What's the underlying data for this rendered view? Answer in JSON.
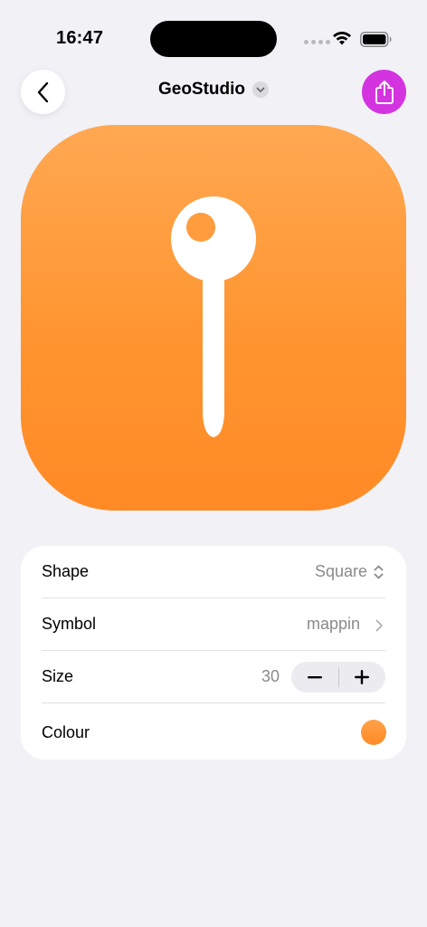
{
  "status_bar": {
    "time": "16:47"
  },
  "nav": {
    "title": "GeoStudio"
  },
  "icon_preview": {
    "symbol": "mappin",
    "background_color": "#ff9530",
    "symbol_color": "#ffffff"
  },
  "settings": {
    "shape": {
      "label": "Shape",
      "value": "Square"
    },
    "symbol": {
      "label": "Symbol",
      "value": "mappin"
    },
    "size": {
      "label": "Size",
      "value": "30"
    },
    "colour": {
      "label": "Colour",
      "swatch": "#ff9530"
    }
  },
  "colors": {
    "accent": "#d434e0",
    "background": "#f2f1f6"
  }
}
